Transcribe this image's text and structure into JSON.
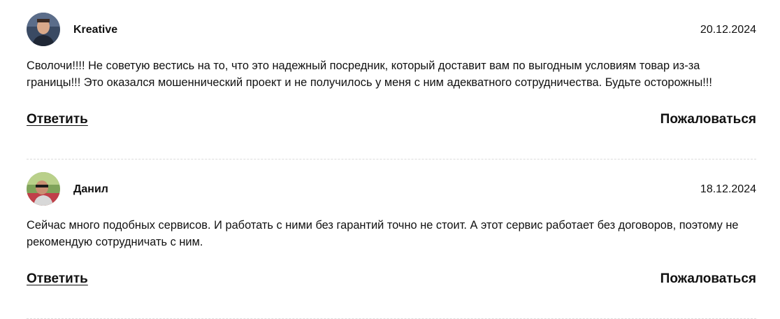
{
  "reviews": [
    {
      "author": "Kreative",
      "date": "20.12.2024",
      "text": "Сволочи!!!! Не советую вестись на то, что это надежный посредник, который доставит вам по выгодным условиям товар из-за границы!!! Это оказался мошеннический проект и не получилось у меня с ним адекватного сотрудничества. Будьте осторожны!!!",
      "reply_label": "Ответить",
      "complain_label": "Пожаловаться",
      "avatar_icon": "user-avatar-photo"
    },
    {
      "author": "Данил",
      "date": "18.12.2024",
      "text": "Сейчас много подобных сервисов. И работать с ними без гарантий точно не стоит. А этот сервис работает без договоров, поэтому не рекомендую сотрудничать с ним.",
      "reply_label": "Ответить",
      "complain_label": "Пожаловаться",
      "avatar_icon": "user-avatar-photo"
    }
  ]
}
